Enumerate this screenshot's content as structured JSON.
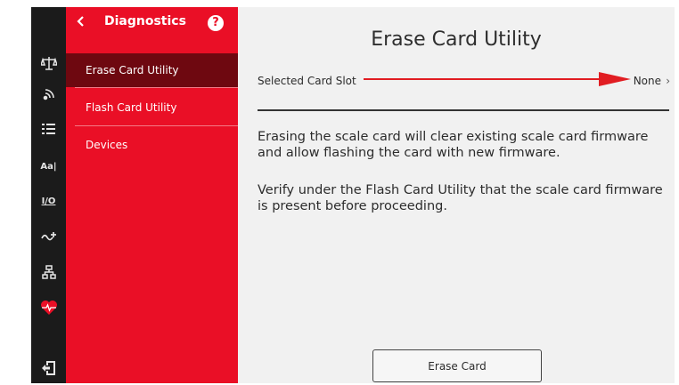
{
  "rail": {
    "icons": [
      {
        "name": "scale-balance-icon"
      },
      {
        "name": "wireless-icon"
      },
      {
        "name": "list-icon"
      },
      {
        "name": "font-size-icon",
        "text": "Aa|"
      },
      {
        "name": "io-icon",
        "text": "I/O"
      },
      {
        "name": "signal-icon"
      },
      {
        "name": "network-icon"
      },
      {
        "name": "diagnostics-heart-icon"
      },
      {
        "name": "logout-icon"
      }
    ],
    "accent_color": "#ea0f26"
  },
  "menu": {
    "title": "Diagnostics",
    "help_glyph": "?",
    "items": [
      {
        "label": "Erase Card Utility",
        "active": true
      },
      {
        "label": "Flash Card Utility",
        "active": false
      },
      {
        "label": "Devices",
        "active": false
      }
    ]
  },
  "content": {
    "title": "Erase Card Utility",
    "slot_label": "Selected Card Slot",
    "slot_value": "None",
    "slot_chevron": "›",
    "paragraph1": "Erasing the scale card will clear existing scale card firmware and allow flashing the card with new firmware.",
    "paragraph2": "Verify under the Flash Card Utility that the scale card firmware is present before proceeding.",
    "button_label": "Erase Card"
  },
  "colors": {
    "menu_bg": "#ea0f26",
    "menu_active": "#6e0810",
    "rail_bg": "#1b1b1b",
    "content_bg": "#f1f1f1",
    "annotation_arrow": "#e11d22"
  }
}
